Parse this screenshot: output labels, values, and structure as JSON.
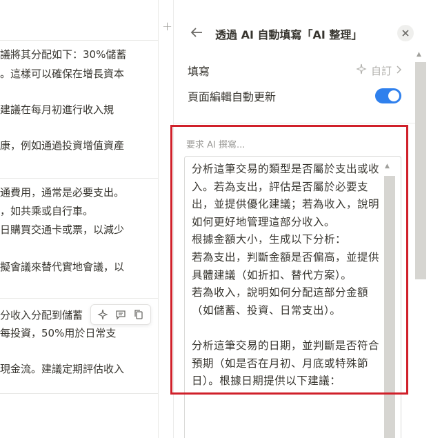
{
  "left_table": {
    "rows": [
      "議將其分配如下：30%儲蓄",
      "。這樣可以確保在增長資本",
      "建議在每月初進行收入規",
      "康，例如通過投資增值資產",
      "通費用，通常是必要支出。",
      "，如共乘或自行車。",
      "日購買交通卡或票，以減少",
      "擬會議來替代實地會議，以",
      "分收入分配到儲蓄",
      "每投資，50%用於日常支",
      "現金流。建議定期評估收入"
    ]
  },
  "panel": {
    "title": "透過 AI 自動填寫「AI 整理」",
    "fill_label": "填寫",
    "fill_value": "自訂",
    "auto_update_label": "頁面編輯自動更新",
    "auto_update_enabled": true,
    "prompt_label": "要求 AI 撰寫...",
    "prompt_text": "分析這筆交易的類型是否屬於支出或收入。若為支出，評估是否屬於必要支出，並提供優化建議；若為收入，說明如何更好地管理這部分收入。\n根據金額大小，生成以下分析：\n若為支出，判斷金額是否偏高，並提供具體建議（如折扣、替代方案）。\n若為收入，說明如何分配這部分金額（如儲蓄、投資、日常支出）。\n\n分析這筆交易的日期，並判斷是否符合預期（如是否在月初、月底或特殊節日）。根據日期提供以下建議：",
    "accent_color": "#2f80ed",
    "highlight_color": "#d0202a"
  },
  "icons": {
    "back": "arrow-left-icon",
    "close": "close-icon",
    "sparkle": "sparkle-icon",
    "chevron": "chevron-right-icon",
    "comment": "comment-icon",
    "copy": "copy-icon",
    "add_column": "plus-icon"
  }
}
